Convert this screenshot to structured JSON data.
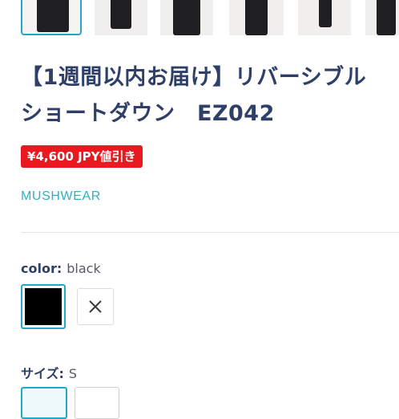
{
  "product": {
    "title": "【1週間以内お届け】リバーシブルショートダウン　EZ042",
    "discount_badge": "¥4,600 JPY値引き",
    "vendor": "MUSHWEAR"
  },
  "options": {
    "color": {
      "name": "color:",
      "selected_value": "black",
      "swatches": [
        {
          "label": "black",
          "color": "#000000",
          "selected": true
        },
        {
          "label": "unavailable",
          "icon": "close-icon",
          "selected": false
        }
      ]
    },
    "size": {
      "name": "サイズ:",
      "selected_value": "S"
    }
  },
  "colors": {
    "accent": "#22a9c4",
    "title": "#2f4068",
    "badge": "#e8191f",
    "vendor": "#2bb3c3"
  }
}
